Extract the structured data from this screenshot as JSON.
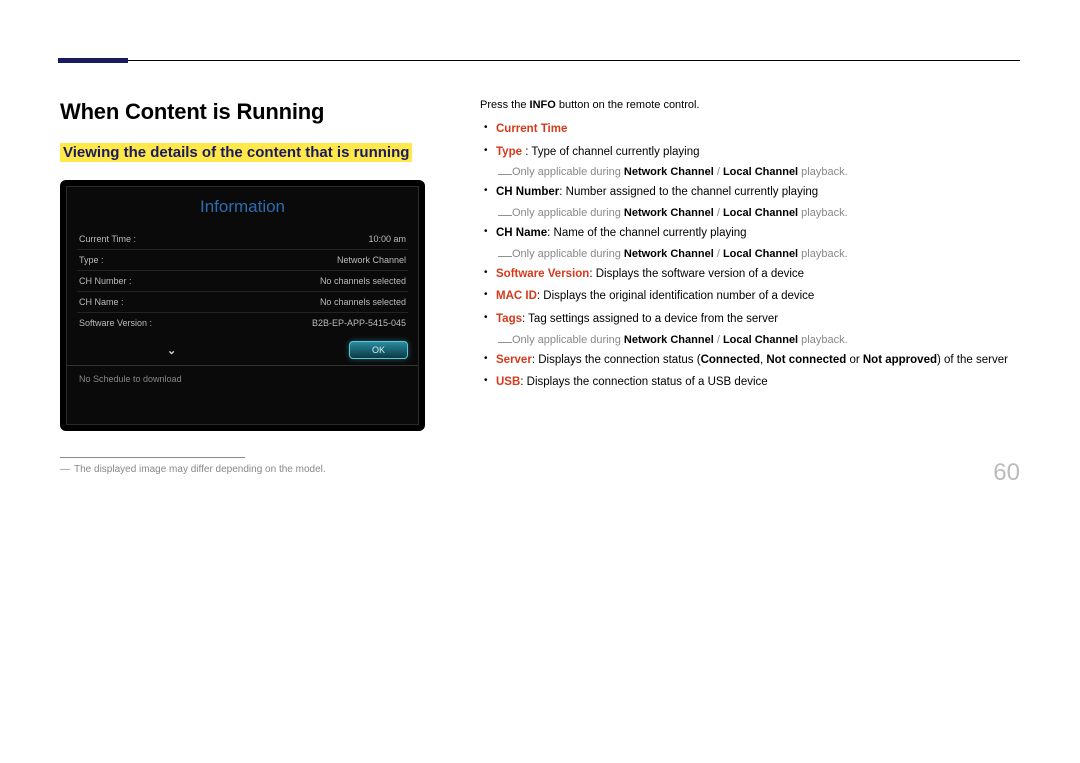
{
  "heading": "When Content is Running",
  "subheading": "Viewing the details of the content that is running",
  "screenshot": {
    "title": "Information",
    "rows": [
      {
        "label": "Current Time :",
        "value": "10:00 am"
      },
      {
        "label": "Type :",
        "value": "Network Channel"
      },
      {
        "label": "CH Number :",
        "value": "No channels selected"
      },
      {
        "label": "CH Name :",
        "value": "No channels selected"
      },
      {
        "label": "Software Version :",
        "value": "B2B-EP-APP-5415-045"
      }
    ],
    "ok": "OK",
    "lower": "No Schedule to download"
  },
  "footnote": "The displayed image may differ depending on the model.",
  "intro": {
    "pre": "Press the ",
    "bold": "INFO",
    "post": " button on the remote control."
  },
  "items": {
    "current_time": "Current Time",
    "type_label": "Type",
    "type_text": " : Type of channel currently playing",
    "note_pre": "Only applicable during ",
    "nc": "Network Channel",
    "lc": "Local Channel",
    "note_post": " playback.",
    "chnum_label": "CH Number",
    "chnum_text": ": Number assigned to the channel currently playing",
    "chname_label": "CH Name",
    "chname_text": ": Name of the channel currently playing",
    "sw_label": "Software Version",
    "sw_text": ": Displays the software version of a device",
    "mac_label": "MAC ID",
    "mac_text": ": Displays the original identification number of a device",
    "tags_label": "Tags",
    "tags_text": ": Tag settings assigned to a device from the server",
    "server_label": "Server",
    "server_pre": ": Displays the connection status (",
    "connected": "Connected",
    "notconnected": "Not connected",
    "or": " or ",
    "notapproved": "Not approved",
    "server_post": ") of the server",
    "usb_label": "USB",
    "usb_text": ": Displays the connection status of a USB device",
    "sep": ", ",
    "slash": " / "
  },
  "page_number": "60"
}
